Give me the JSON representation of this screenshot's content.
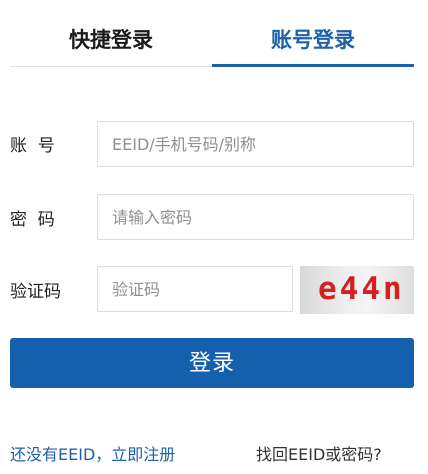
{
  "tabs": {
    "quick_login": "快捷登录",
    "account_login": "账号登录",
    "active": "account_login"
  },
  "form": {
    "account_label": "账  号",
    "account_placeholder": "EEID/手机号码/别称",
    "account_value": "",
    "password_label": "密  码",
    "password_placeholder": "请输入密码",
    "password_value": "",
    "captcha_label": "验证码",
    "captcha_placeholder": "验证码",
    "captcha_value": "",
    "captcha_image_text": "e44n"
  },
  "actions": {
    "login_label": "登录"
  },
  "links": {
    "register": "还没有EEID，立即注册",
    "recover": "找回EEID或密码?"
  },
  "colors": {
    "accent": "#1e60a9",
    "button": "#1560ad",
    "captcha_text": "#d61f1f"
  }
}
